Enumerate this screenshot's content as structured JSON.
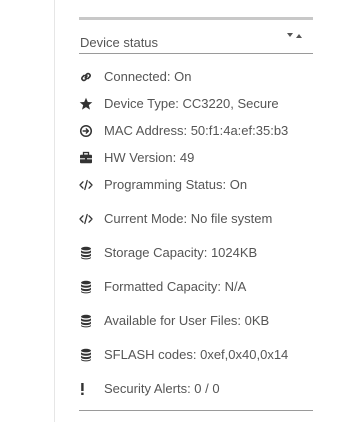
{
  "panel": {
    "title": "Device status"
  },
  "rows": [
    {
      "icon": "link-icon",
      "text": "Connected: On"
    },
    {
      "icon": "star-icon",
      "text": "Device Type: CC3220, Secure"
    },
    {
      "icon": "arrow-circle-icon",
      "text": "MAC Address: 50:f1:4a:ef:35:b3"
    },
    {
      "icon": "briefcase-icon",
      "text": "HW Version: 49"
    },
    {
      "icon": "code-icon",
      "text": "Programming Status: On"
    },
    {
      "icon": "code-icon",
      "text": "Current Mode: No file system"
    },
    {
      "icon": "database-icon",
      "text": "Storage Capacity: 1024KB"
    },
    {
      "icon": "database-icon",
      "text": "Formatted Capacity: N/A"
    },
    {
      "icon": "database-icon",
      "text": "Available for User Files: 0KB"
    },
    {
      "icon": "database-icon",
      "text": "SFLASH codes: 0xef,0x40,0x14"
    },
    {
      "icon": "exclamation-icon",
      "text": "Security Alerts: 0 / 0"
    }
  ]
}
